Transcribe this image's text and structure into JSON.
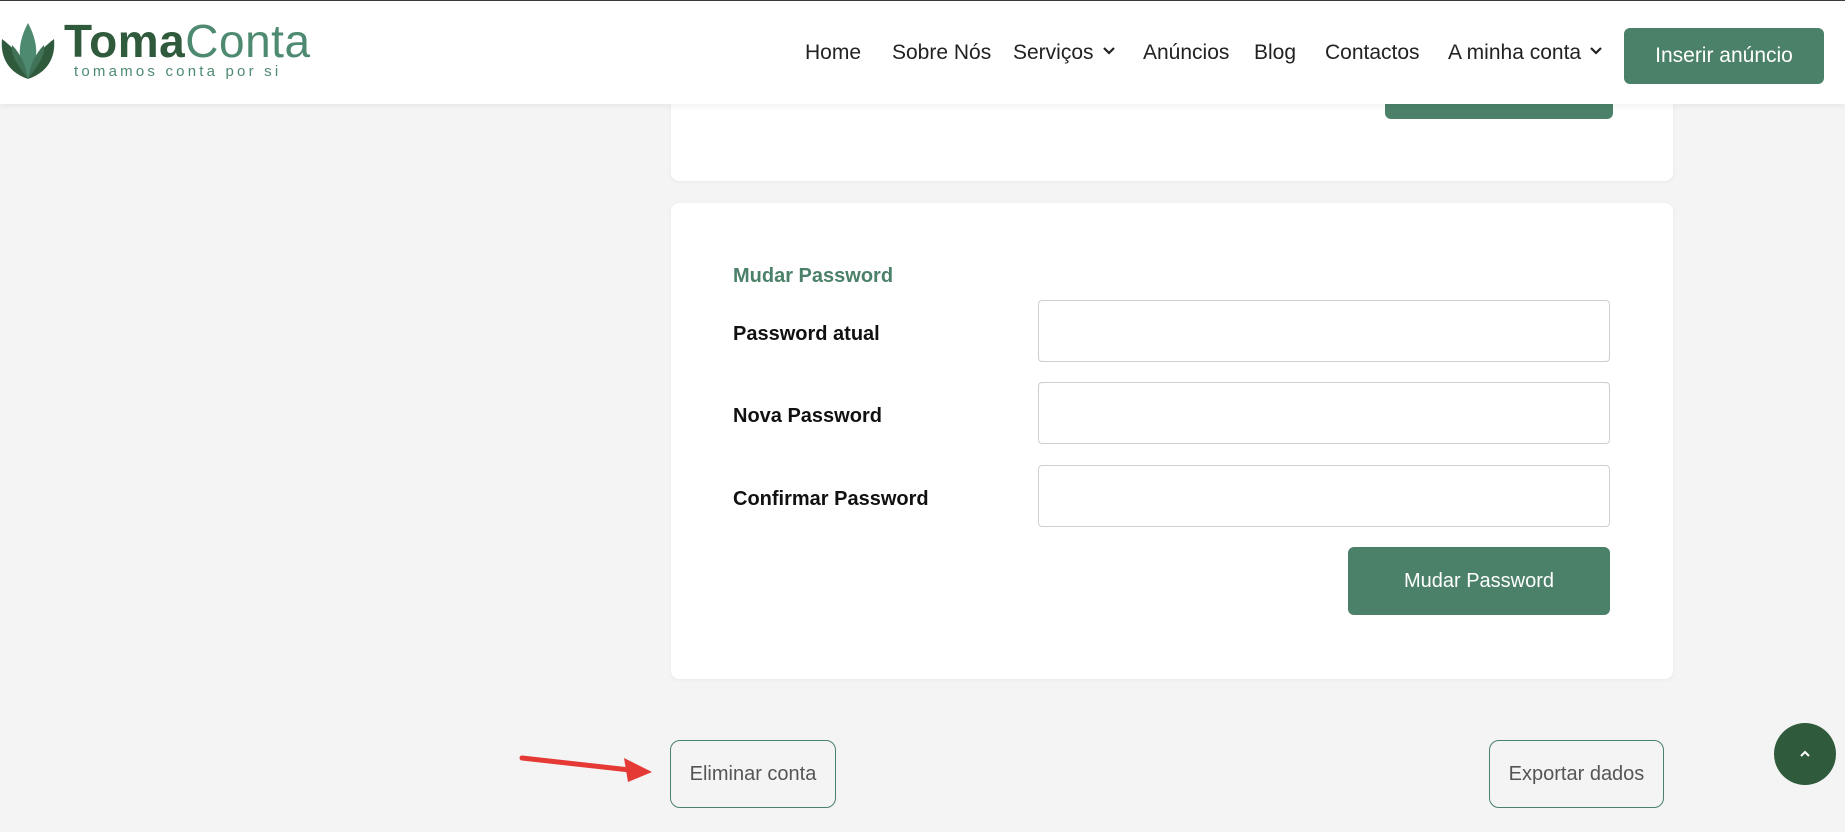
{
  "brand": {
    "name_part1": "Toma",
    "name_part2": "Conta",
    "tagline": "tomamos conta por si"
  },
  "nav": {
    "items": [
      {
        "label": "Home"
      },
      {
        "label": "Sobre Nós"
      },
      {
        "label": "Serviços"
      },
      {
        "label": "Anúncios"
      },
      {
        "label": "Blog"
      },
      {
        "label": "Contactos"
      },
      {
        "label": "A minha conta"
      }
    ],
    "cta_label": "Inserir anúncio"
  },
  "password_section": {
    "title": "Mudar Password",
    "fields": [
      {
        "label": "Password atual",
        "value": ""
      },
      {
        "label": "Nova Password",
        "value": ""
      },
      {
        "label": "Confirmar Password",
        "value": ""
      }
    ],
    "submit_label": "Mudar Password"
  },
  "account_actions": {
    "delete_label": "Eliminar conta",
    "export_label": "Exportar dados"
  },
  "icons": {
    "logo": "lotus-leaf-icon",
    "dropdown": "chevron-down-icon",
    "scroll_top": "chevron-up-icon",
    "annotation": "red-arrow-icon"
  },
  "colors": {
    "brand_dark": "#2f5a3b",
    "brand_primary": "#4b8169",
    "page_bg": "#f4f4f4",
    "annotation_red": "#e53935"
  }
}
